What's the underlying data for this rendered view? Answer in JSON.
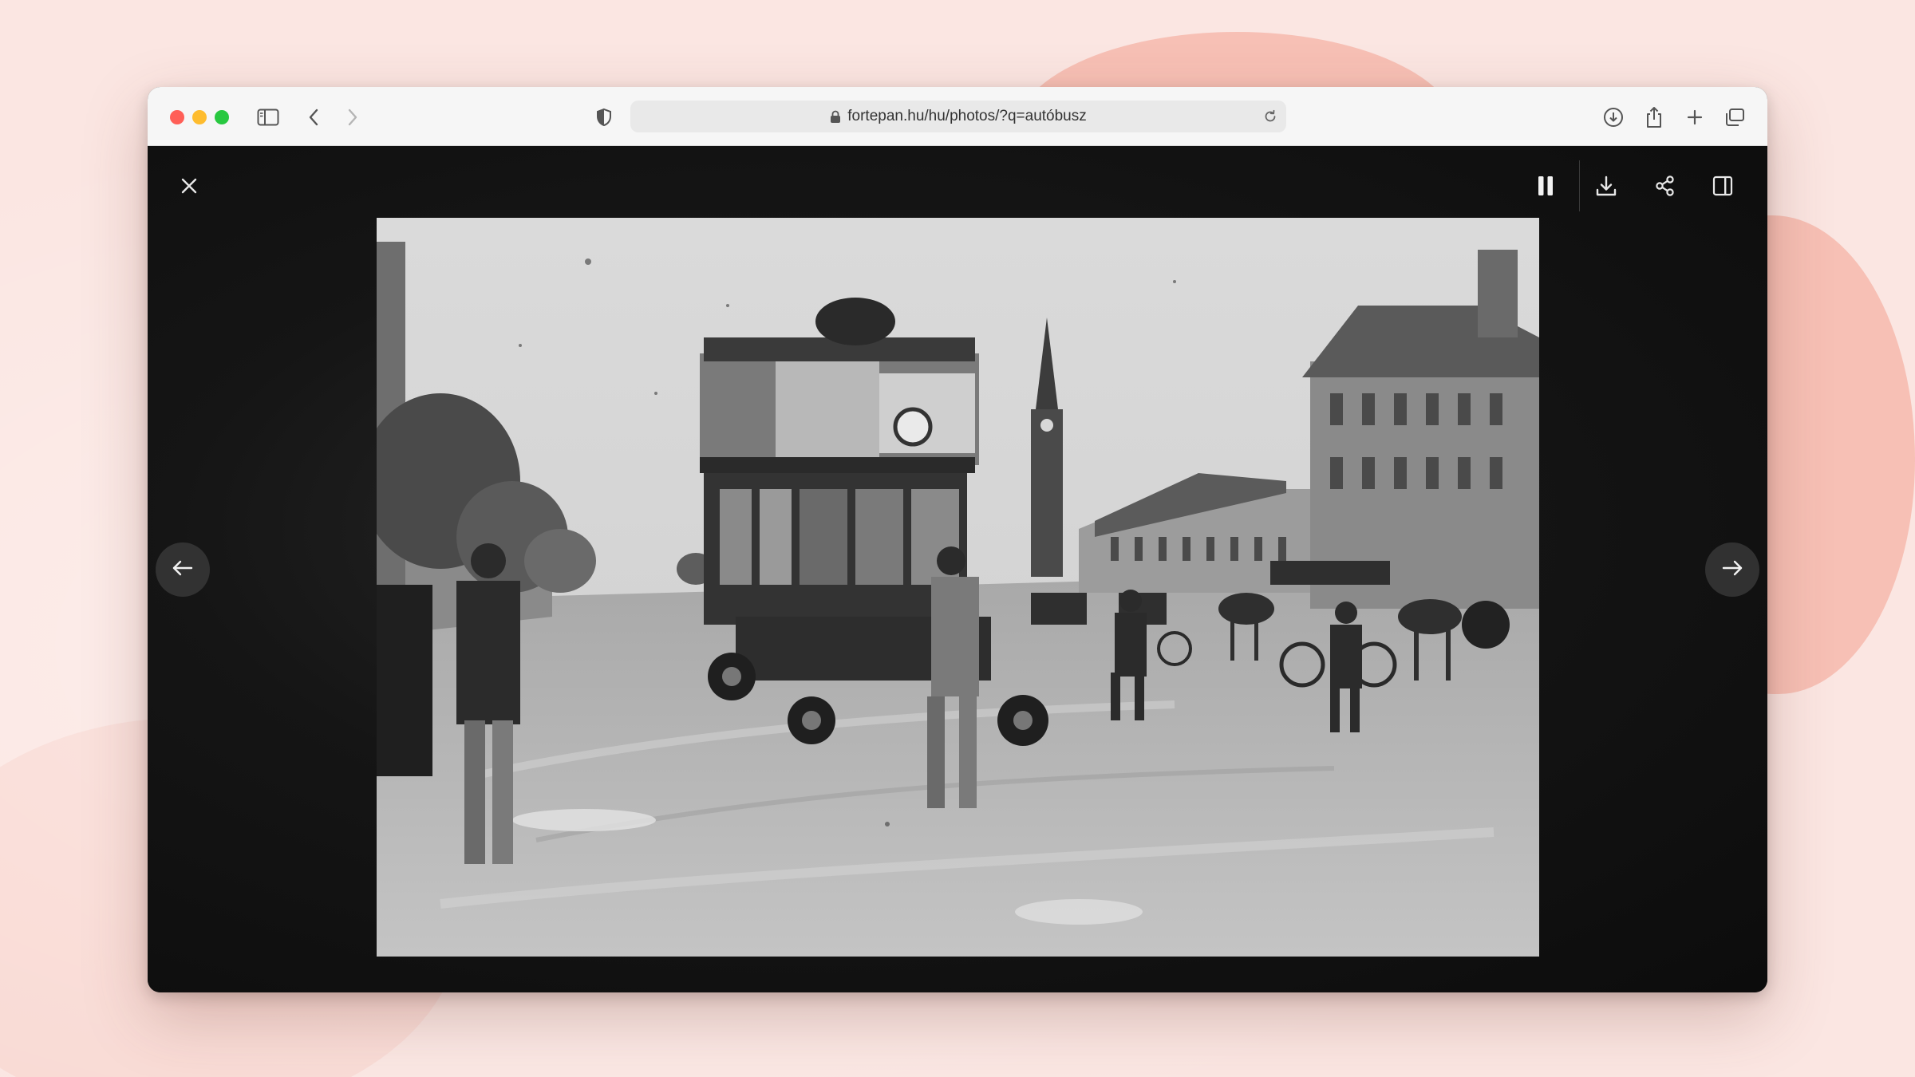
{
  "browser": {
    "url": "fortepan.hu/hu/photos/?q=autóbusz",
    "icons": {
      "sidebar": "sidebar-icon",
      "back": "chevron-left-icon",
      "forward": "chevron-right-icon",
      "privacy": "shield-icon",
      "lock": "lock-icon",
      "reload": "reload-icon",
      "downloads": "download-circle-icon",
      "share": "share-icon",
      "new_tab": "plus-icon",
      "tabs": "tabs-overview-icon"
    }
  },
  "viewer": {
    "icons": {
      "close": "close-icon",
      "pause": "pause-icon",
      "download": "download-icon",
      "share": "share-nodes-icon",
      "panel": "side-panel-icon",
      "prev": "arrow-left-icon",
      "next": "arrow-right-icon"
    },
    "photo": {
      "subject": "double-decker autobus street scene",
      "tone": "black-and-white",
      "colors": {
        "sky": "#d6d6d6",
        "street": "#b3b3b3",
        "dark": "#2b2b2b"
      }
    }
  },
  "colors": {
    "page_bg": "#fbe6e2",
    "accent_blob": "#f6b8ad",
    "toolbar_bg": "#f6f6f6",
    "viewer_bg": "#151515"
  }
}
